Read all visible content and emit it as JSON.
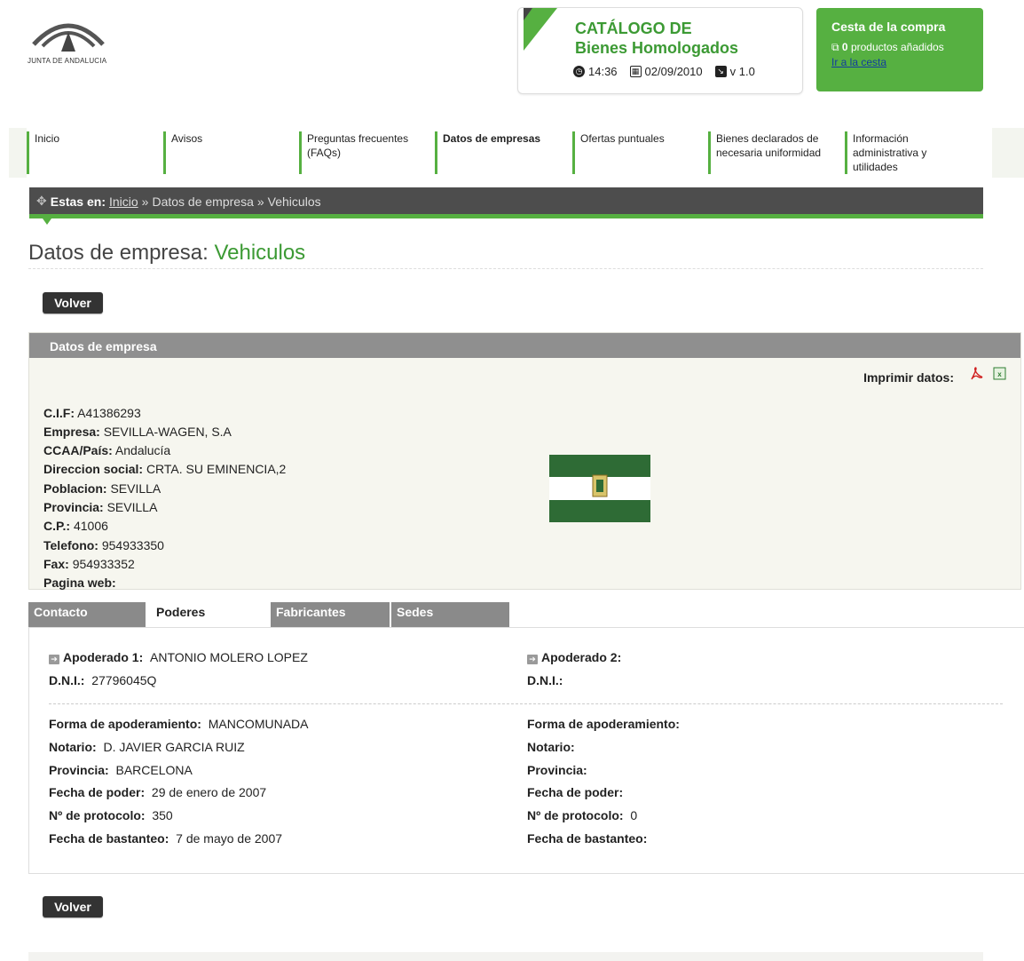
{
  "header": {
    "logo_text": "JUNTA DE ANDALUCIA",
    "catalog_title_line1": "CATÁLOGO DE",
    "catalog_title_line2": "Bienes Homologados",
    "time": "14:36",
    "date": "02/09/2010",
    "version": "v 1.0"
  },
  "cart": {
    "title": "Cesta de la compra",
    "count": "0",
    "count_text": "productos añadidos",
    "link": "Ir a la cesta"
  },
  "nav": [
    {
      "line1": "Inicio",
      "line2": "",
      "line3": ""
    },
    {
      "line1": "Avisos",
      "line2": "",
      "line3": ""
    },
    {
      "line1": "Preguntas frecuentes",
      "line2": "(FAQs)",
      "line3": ""
    },
    {
      "line1": "Datos de empresas",
      "line2": "",
      "line3": ""
    },
    {
      "line1": "Ofertas puntuales",
      "line2": "",
      "line3": ""
    },
    {
      "line1": "Bienes declarados de",
      "line2": "necesaria uniformidad",
      "line3": ""
    },
    {
      "line1": "Información",
      "line2": "administrativa y",
      "line3": "utilidades"
    }
  ],
  "breadcrumb": {
    "label": "Estas en:",
    "home": "Inicio",
    "sep1": "»",
    "item1": "Datos de empresa",
    "sep2": "»",
    "item2": "Vehiculos"
  },
  "page": {
    "title_prefix": "Datos de empresa: ",
    "title_accent": "Vehiculos",
    "back_button": "Volver"
  },
  "company": {
    "panel_title": "Datos de empresa",
    "print_label": "Imprimir datos:",
    "fields": [
      {
        "label": "C.I.F:",
        "value": "A41386293"
      },
      {
        "label": "Empresa:",
        "value": "SEVILLA-WAGEN, S.A"
      },
      {
        "label": "CCAA/País:",
        "value": "Andalucía"
      },
      {
        "label": "Direccion social:",
        "value": "CRTA. SU EMINENCIA,2"
      },
      {
        "label": "Poblacion:",
        "value": "SEVILLA"
      },
      {
        "label": "Provincia:",
        "value": "SEVILLA"
      },
      {
        "label": "C.P.:",
        "value": "41006"
      },
      {
        "label": "Telefono:",
        "value": "954933350"
      },
      {
        "label": "Fax:",
        "value": "954933352"
      },
      {
        "label": "Pagina web:",
        "value": ""
      }
    ]
  },
  "tabs": [
    "Contacto",
    "Poderes",
    "Fabricantes",
    "Sedes"
  ],
  "powers": {
    "left": {
      "apoderado_label": "Apoderado 1:",
      "apoderado_value": "ANTONIO MOLERO LOPEZ",
      "dni_label": "D.N.I.:",
      "dni_value": "27796045Q",
      "forma_label": "Forma de apoderamiento:",
      "forma_value": "MANCOMUNADA",
      "notario_label": "Notario:",
      "notario_value": "D. JAVIER GARCIA RUIZ",
      "provincia_label": "Provincia:",
      "provincia_value": "BARCELONA",
      "fecha_label": "Fecha de poder:",
      "fecha_value": "29 de enero de 2007",
      "protocolo_label": "Nº de protocolo:",
      "protocolo_value": "350",
      "bastanteo_label": "Fecha de bastanteo:",
      "bastanteo_value": "7 de mayo de 2007"
    },
    "right": {
      "apoderado_label": "Apoderado 2:",
      "apoderado_value": "",
      "dni_label": "D.N.I.:",
      "dni_value": "",
      "forma_label": "Forma de apoderamiento:",
      "forma_value": "",
      "notario_label": "Notario:",
      "notario_value": "",
      "provincia_label": "Provincia:",
      "provincia_value": "",
      "fecha_label": "Fecha de poder:",
      "fecha_value": "",
      "protocolo_label": "Nº de protocolo:",
      "protocolo_value": "0",
      "bastanteo_label": "Fecha de bastanteo:",
      "bastanteo_value": ""
    }
  },
  "colors": {
    "brand_green": "#56b041",
    "title_green": "#3c9a34",
    "dark_bar": "#4d4d4d"
  },
  "icons": [
    "clock-icon",
    "calendar-icon",
    "version-icon",
    "cart-icon",
    "move-icon",
    "pdf-icon",
    "excel-icon",
    "arrow-right-icon",
    "andalucia-flag"
  ]
}
